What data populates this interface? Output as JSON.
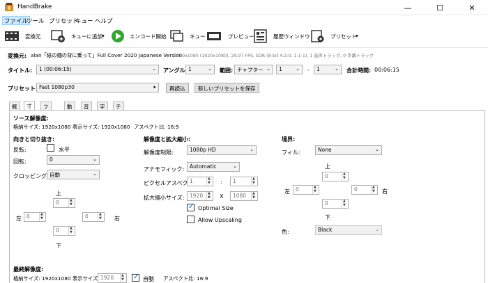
{
  "window": {
    "title": "HandBrake",
    "minimize": "—",
    "maximize": "☐",
    "close": "✕"
  },
  "menu": [
    "ファイル",
    "ツール",
    "プリセット",
    "キュー",
    "ヘルプ"
  ],
  "toolbar": {
    "source": "変換元",
    "add_queue": "キューに追加",
    "add_queue_arrow": "▾",
    "start": "エンコード開始",
    "queue": "キュー",
    "preview": "プレビュー",
    "activity": "履歴ウィンドウ",
    "presets": "プリセット",
    "presets_arrow": "▾"
  },
  "source": {
    "label": "変換元:",
    "name": "alan「紙の麺の背に乗って」Full Cover 2020 Japanese Version",
    "info": "1920x1080 (1920x1080), 29.97 FPS, SDR (8-bit 4:2:0, 1-1-1), 1 音声トラック, 0 字幕トラック"
  },
  "title_row": {
    "title_label": "タイトル:",
    "title_value": "1 (00:06:15)",
    "angle_label": "アングル:",
    "angle_value": "1",
    "range_label": "範囲:",
    "range_type": "チャプター",
    "range_from": "1",
    "range_dash": "-",
    "range_to": "1",
    "duration_label": "合計時間:",
    "duration_value": "00:06:15"
  },
  "preset_row": {
    "label": "プリセット:",
    "value": "Fast 1080p30",
    "reload": "再読込",
    "save_new": "新しいプリセットを保存"
  },
  "tabs": [
    "概要",
    "寸法",
    "フィルタ",
    "動画",
    "音声",
    "字幕",
    "チャプター"
  ],
  "source_res": {
    "heading": "ソース解像度:",
    "storage": "格納サイズ: 1920x1080",
    "display": "表示サイズ: 1920x1080",
    "aspect": "アスペクト比: 16:9"
  },
  "orientation": {
    "heading": "向きと切り抜き:",
    "flip_label": "反転:",
    "flip_option": "水平",
    "rotate_label": "回転:",
    "rotate_value": "0",
    "crop_label": "クロッピング:",
    "crop_value": "自動",
    "top": "上",
    "bottom": "下",
    "left": "左",
    "right": "右",
    "crop_top": "0",
    "crop_bottom": "0",
    "crop_left": "0",
    "crop_right": "0"
  },
  "resolution": {
    "heading": "解像度と拡大縮小:",
    "limit_label": "解像度制限:",
    "limit_value": "1080p HD",
    "anamorphic_label": "アナモフィック:",
    "anamorphic_value": "Automatic",
    "par_label": "ピクセルアスペクト比:",
    "par_x": "1",
    "par_colon": ":",
    "par_y": "1",
    "scale_label": "拡大縮小サイズ:",
    "scale_w": "1920",
    "scale_x": "X",
    "scale_h": "1080",
    "optimal": "Optimal Size",
    "upscaling": "Allow Upscaling"
  },
  "borders": {
    "heading": "境界:",
    "fill_label": "フィル:",
    "fill_value": "None",
    "top": "上",
    "bottom": "下",
    "left": "左",
    "right": "右",
    "b_top": "0",
    "b_bottom": "0",
    "b_left": "0",
    "b_right": "0",
    "color_label": "色:",
    "color_value": "Black"
  },
  "final": {
    "heading": "最終解像度:",
    "storage": "格納サイズ: 1920x1080",
    "display_label": "表示サイズ:",
    "display_value": "1920",
    "auto": "自動",
    "aspect": "アスペクト比: 16:9"
  },
  "colors": {
    "accent": "#0078d7",
    "play_green": "#2fa82f",
    "tab_border": "#b9b9b9"
  }
}
